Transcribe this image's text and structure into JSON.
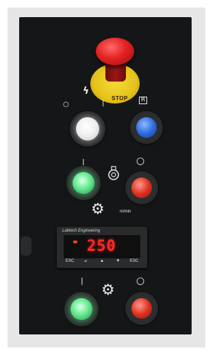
{
  "estop": {
    "label": "STOP"
  },
  "symbols": {
    "off": "○",
    "on": "|",
    "lightning": "ϟ",
    "reset": "R",
    "ring": "○"
  },
  "speed_unit": "m/min",
  "controller": {
    "brand": "Labtech Engineering",
    "value": "250",
    "keys": [
      "ESC",
      "↵",
      "▲",
      "▼",
      "ESC"
    ]
  },
  "colors": {
    "panel": "#151617",
    "estop_red": "#e52222",
    "estop_yellow": "#e5c21a",
    "white_lamp": "#f4f4f4",
    "blue_button": "#2f6de0",
    "green_lamp": "#59e08a",
    "red_button": "#e03222",
    "display_red": "#ff2a25"
  },
  "icons": [
    "gear-icon",
    "speed-gear-icon",
    "motor-icon",
    "lightning-icon"
  ]
}
